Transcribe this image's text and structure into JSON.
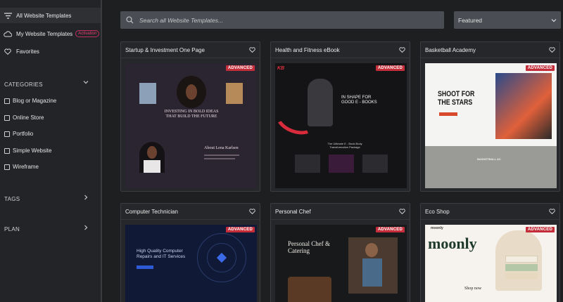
{
  "sidebar": {
    "items": [
      {
        "label": "All Website Templates",
        "icon": "filter-lines-icon"
      },
      {
        "label": "My Website Templates",
        "badge": "Activation",
        "icon": "cloud-icon"
      },
      {
        "label": "Favorites",
        "icon": "heart-icon"
      }
    ],
    "categories_title": "CATEGORIES",
    "categories": [
      "Blog or Magazine",
      "Online Store",
      "Portfolio",
      "Simple Website",
      "Wireframe"
    ],
    "tags_title": "TAGS",
    "plan_title": "PLAN"
  },
  "search": {
    "placeholder": "Search all Website Templates..."
  },
  "sort": {
    "value": "Featured"
  },
  "badge_label": "ADVANCED",
  "cards": [
    {
      "title": "Startup & Investment One Page",
      "thumb": {
        "headline": "INVESTING IN BOLD IDEAS THAT BUILD THE FUTURE",
        "about": "About Lena Karlsen"
      }
    },
    {
      "title": "Health and Fitness eBook",
      "thumb": {
        "logo": "KB",
        "headline": "IN SHAPE FOR GOOD E - BOOKS",
        "sub": "The Ultimate E - Book Body Transformation Package"
      }
    },
    {
      "title": "Basketball Academy",
      "thumb": {
        "headline": "SHOOT FOR THE STARS",
        "court": "BASKETBALL AC"
      }
    },
    {
      "title": "Computer Technician",
      "thumb": {
        "headline": "High Quality Computer Repairs and IT Services"
      }
    },
    {
      "title": "Personal Chef",
      "thumb": {
        "headline": "Personal Chef & Catering"
      }
    },
    {
      "title": "Eco Shop",
      "thumb": {
        "logo": "moonly",
        "brand": "moonly",
        "cta": "Shop now"
      }
    }
  ],
  "colors": {
    "accent": "#c42e3a",
    "badge_pink": "#e2406e",
    "sidebar_bg": "#232427",
    "card_bg": "#26272a"
  }
}
